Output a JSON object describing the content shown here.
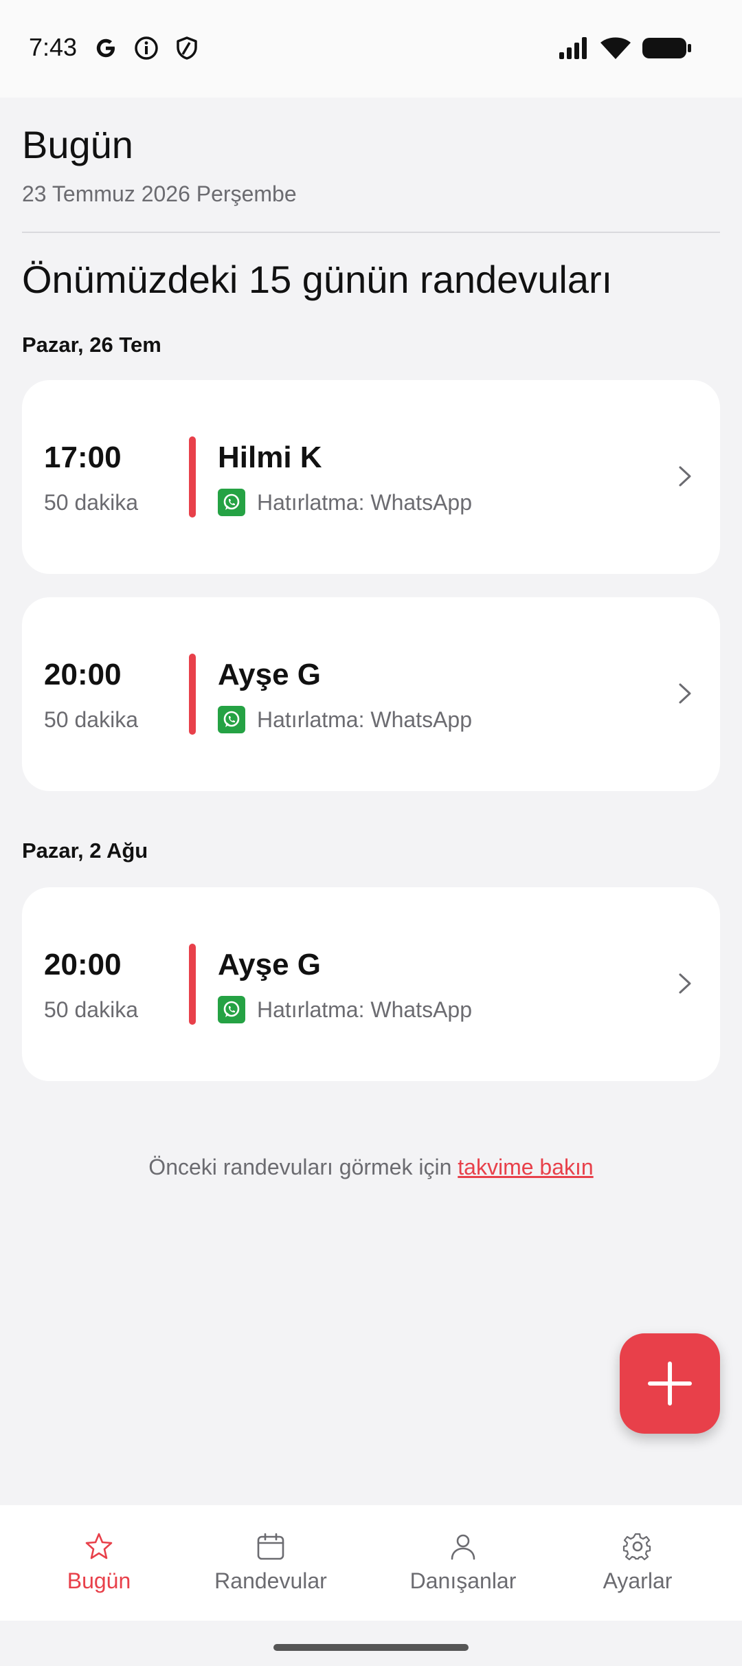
{
  "status_bar": {
    "time": "7:43",
    "left_icons": [
      "google-icon",
      "info-icon",
      "shield-icon"
    ],
    "right_icons": [
      "signal-icon",
      "wifi-icon",
      "battery-icon"
    ]
  },
  "header": {
    "title": "Bugün",
    "date": "23 Temmuz 2026 Perşembe"
  },
  "section_title": "Önümüzdeki 15 günün randevuları",
  "days": [
    {
      "label": "Pazar, 26 Tem",
      "appointments": [
        {
          "time": "17:00",
          "duration": "50 dakika",
          "client": "Hilmi K",
          "reminder": "Hatırlatma: WhatsApp"
        },
        {
          "time": "20:00",
          "duration": "50 dakika",
          "client": "Ayşe G",
          "reminder": "Hatırlatma: WhatsApp"
        }
      ]
    },
    {
      "label": "Pazar, 2 Ağu",
      "appointments": [
        {
          "time": "20:00",
          "duration": "50 dakika",
          "client": "Ayşe G",
          "reminder": "Hatırlatma: WhatsApp"
        }
      ]
    }
  ],
  "footer_note": {
    "text": "Önceki randevuları görmek için ",
    "link": "takvime bakın"
  },
  "fab": {
    "icon": "plus-icon"
  },
  "bottom_nav": [
    {
      "label": "Bugün",
      "icon": "star-icon",
      "active": true
    },
    {
      "label": "Randevular",
      "icon": "calendar-icon",
      "active": false
    },
    {
      "label": "Danışanlar",
      "icon": "person-icon",
      "active": false
    },
    {
      "label": "Ayarlar",
      "icon": "gear-icon",
      "active": false
    }
  ],
  "colors": {
    "accent": "#e8404a",
    "whatsapp": "#25a244",
    "background": "#f3f3f5",
    "card": "#ffffff",
    "muted_text": "#6b6b70"
  }
}
